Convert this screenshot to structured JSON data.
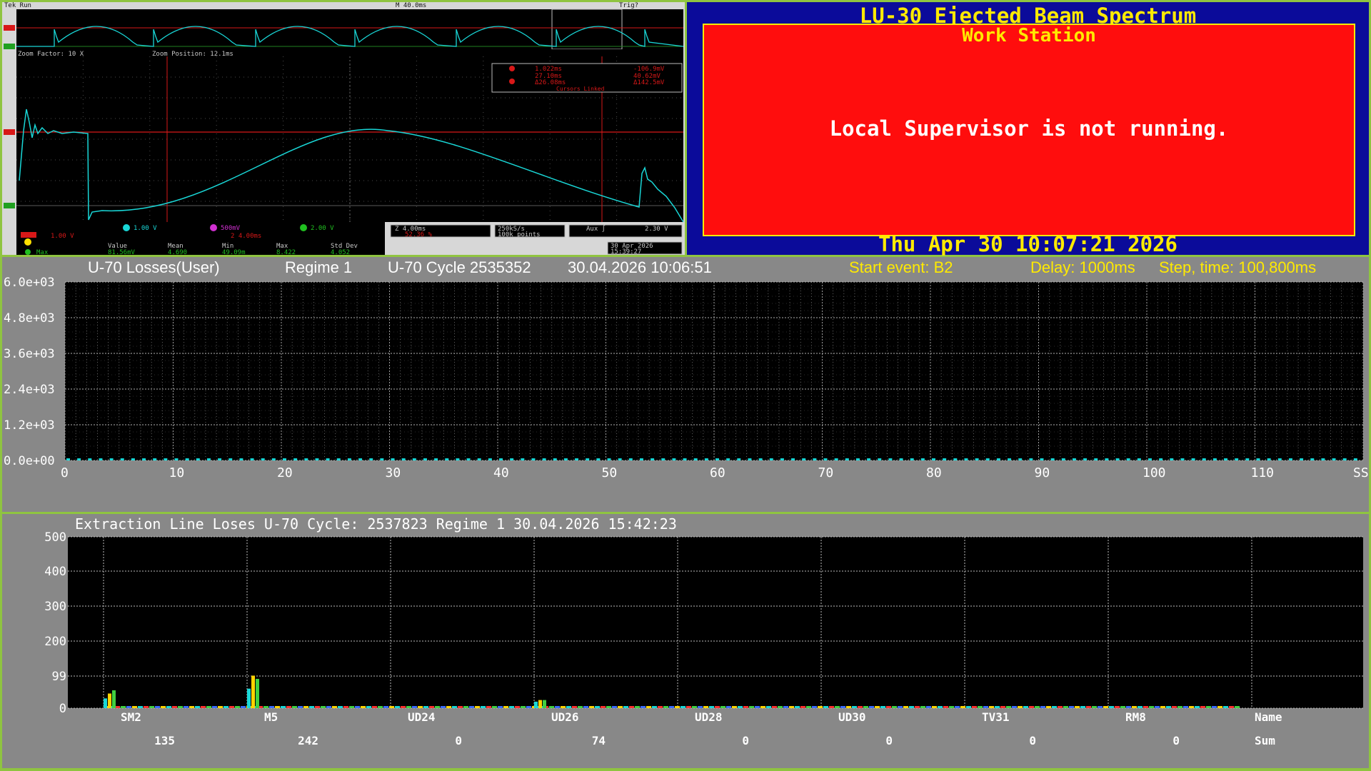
{
  "scope": {
    "status": "Tek Run",
    "timebase": "M 40.0ms",
    "trigger": "Trig?",
    "zoom_factor": "Zoom Factor: 10 X",
    "zoom_position": "Zoom Position: 12.1ms",
    "readout": {
      "a_time": "1.022ms",
      "a_volt": "-106.9mV",
      "b_time": "27.10ms",
      "b_volt": "40.62mV",
      "delta_time": "Δ26.08ms",
      "delta_volt": "Δ142.5mV",
      "linked": "Cursors Linked"
    },
    "ch2_scale": "1.00 V",
    "ch3_scale": "500mV",
    "ch4_scale": "2.00 V",
    "ch1_scale": "1.00 V",
    "ch1_time": "2 4.00ms",
    "zoom_time": "Z 4.00ms",
    "zoom_pct": "52.36 %",
    "sample_rate": "250kS/s",
    "points": "100k points",
    "aux": "Aux ∫",
    "aux_level": "2.30 V",
    "meas_headers": [
      "Value",
      "Mean",
      "Min",
      "Max",
      "Std Dev"
    ],
    "meas_label": "Max",
    "meas_values": [
      "81.56mV",
      "4.690",
      "49.09m",
      "8.422",
      "4.052"
    ],
    "date": "30 Apr 2026",
    "time": "15:39:27",
    "colors": {
      "trace": "#19d7d7",
      "ref": "#d81818",
      "bg": "#000000"
    }
  },
  "lu30": {
    "title": "LU-30 Ejected Beam Spectrum",
    "subtitle": "Work Station",
    "message": "Local Supervisor is not running.",
    "datetime": "Thu Apr 30 10:07:21 2026",
    "colors": {
      "bg": "#0b0b9a",
      "panel": "#ff0d0d",
      "text": "#ffea00"
    }
  },
  "losses": {
    "title": "U-70 Losses(User)",
    "regime": "Regime 1",
    "cycle": "U-70 Cycle 2535352",
    "datetime": "30.04.2026 10:06:51",
    "start_event": "Start event: B2",
    "delay": "Delay: 1000ms",
    "step": "Step, time: 100,800ms"
  },
  "extraction": {
    "header": "Extraction Line  Loses U-70 Cycle: 2537823 Regime 1 30.04.2026 15:42:23"
  },
  "chart_data": [
    {
      "type": "bar",
      "title": "U-70 Losses(User)",
      "y_ticks": [
        "6.0e+03",
        "4.8e+03",
        "3.6e+03",
        "2.4e+03",
        "1.2e+03",
        "0.0e+00"
      ],
      "x_ticks": [
        "0",
        "10",
        "20",
        "30",
        "40",
        "50",
        "60",
        "70",
        "80",
        "90",
        "100",
        "110",
        "SS"
      ],
      "ylim": [
        0,
        6000
      ],
      "xlim": [
        0,
        120
      ],
      "values_note": "all bins near 0",
      "grid": true
    },
    {
      "type": "bar",
      "y_ticks": [
        "500",
        "400",
        "300",
        "200",
        "99",
        "0"
      ],
      "ylim": [
        0,
        500
      ],
      "categories": [
        "SM2",
        "M5",
        "UD24",
        "UD26",
        "UD28",
        "UD30",
        "TV31",
        "RM8"
      ],
      "sums": [
        "135",
        "242",
        "0",
        "74",
        "0",
        "0",
        "0",
        "0"
      ],
      "name_label": "Name",
      "sum_label": "Sum",
      "bar_values": [
        [
          30,
          45,
          55
        ],
        [
          60,
          100,
          90
        ],
        [
          0,
          0,
          0
        ],
        [
          20,
          25,
          25
        ],
        [
          0,
          0,
          0
        ],
        [
          0,
          0,
          0
        ],
        [
          0,
          0,
          0
        ],
        [
          0,
          0,
          0
        ]
      ],
      "grid": true
    }
  ]
}
